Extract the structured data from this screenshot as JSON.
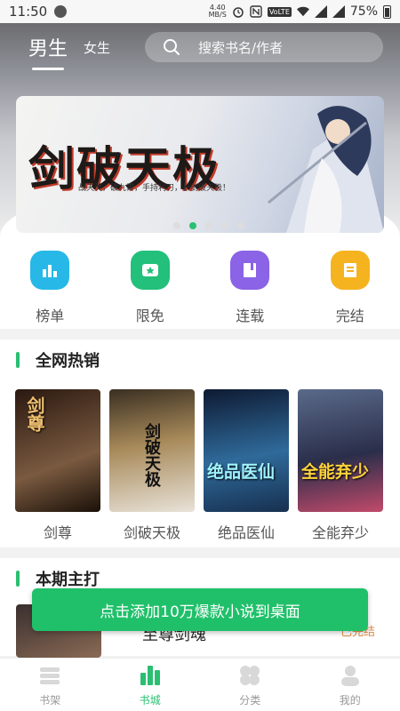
{
  "status_bar": {
    "time": "11:50",
    "speed_value": "4.40",
    "speed_unit": "MB/S",
    "network_badge": "VoLTE",
    "battery": "75%"
  },
  "header": {
    "tabs": [
      {
        "label": "男生",
        "active": true
      },
      {
        "label": "女生",
        "active": false
      }
    ],
    "search_placeholder": "搜索书名/作者"
  },
  "banner": {
    "title": "剑破天极",
    "subtitle": "战天灵，破九霄，手持利刃，长剑破天极！",
    "dots_count": 5,
    "active_dot": 1
  },
  "categories": [
    {
      "label": "榜单",
      "icon": "chart-icon",
      "color": "#27b8e8"
    },
    {
      "label": "限免",
      "icon": "star-badge-icon",
      "color": "#22c07a"
    },
    {
      "label": "连载",
      "icon": "book-icon",
      "color": "#8a63e6"
    },
    {
      "label": "完结",
      "icon": "document-icon",
      "color": "#f5b320"
    }
  ],
  "hot_section": {
    "title": "全网热销",
    "books": [
      {
        "name": "剑尊",
        "cover_text": "剑尊",
        "cover_color": "#3a2418"
      },
      {
        "name": "剑破天极",
        "cover_text": "剑破天极",
        "cover_color": "#4a3a2a"
      },
      {
        "name": "绝品医仙",
        "cover_text": "绝品医仙",
        "cover_color": "#1c3250"
      },
      {
        "name": "全能弃少",
        "cover_text": "全能弃少",
        "cover_color": "#2a2e4a"
      }
    ]
  },
  "main_section": {
    "title": "本期主打",
    "book_name": "至尊剑魂",
    "status": "已完结"
  },
  "toast": {
    "text": "点击添加10万爆款小说到桌面"
  },
  "bottom_nav": [
    {
      "label": "书架",
      "icon": "bookshelf-icon",
      "active": false
    },
    {
      "label": "书城",
      "icon": "bookstore-icon",
      "active": true
    },
    {
      "label": "分类",
      "icon": "category-icon",
      "active": false
    },
    {
      "label": "我的",
      "icon": "profile-icon",
      "active": false
    }
  ]
}
